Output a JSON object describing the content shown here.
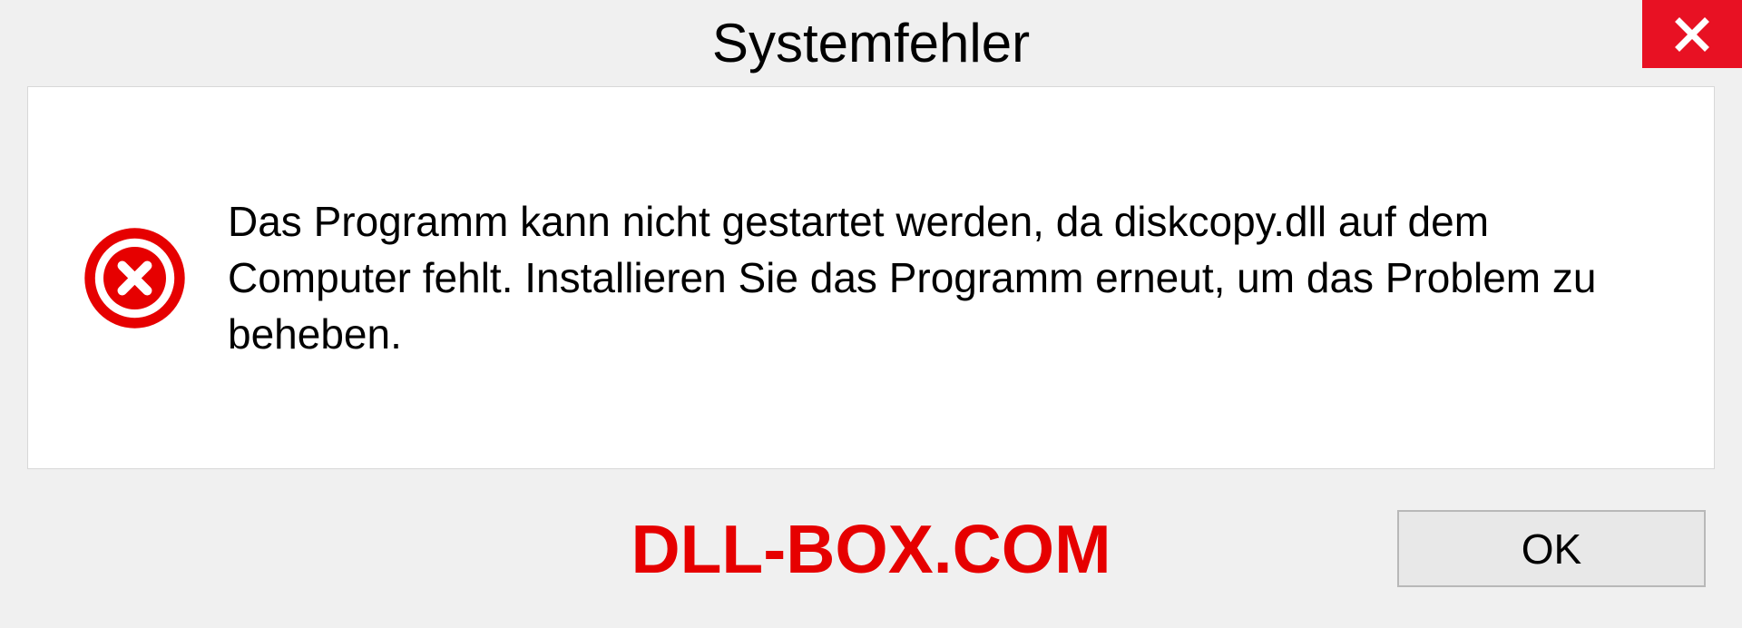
{
  "dialog": {
    "title": "Systemfehler",
    "message": "Das Programm kann nicht gestartet werden, da diskcopy.dll auf dem Computer fehlt. Installieren Sie das Programm erneut, um das Problem zu beheben.",
    "ok_label": "OK"
  },
  "watermark": "DLL-BOX.COM"
}
